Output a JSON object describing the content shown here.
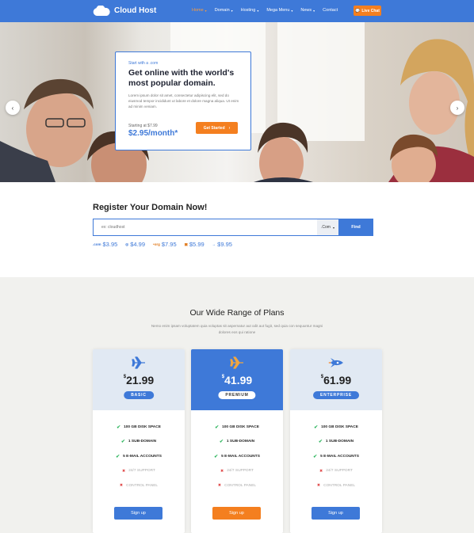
{
  "brand": {
    "name": "Cloud Host"
  },
  "nav": {
    "items": [
      {
        "label": "Home",
        "dropdown": true,
        "active": true
      },
      {
        "label": "Domain",
        "dropdown": true
      },
      {
        "label": "Hosting",
        "dropdown": true
      },
      {
        "label": "Mega Menu",
        "dropdown": true
      },
      {
        "label": "News",
        "dropdown": true
      },
      {
        "label": "Contact",
        "dropdown": false
      }
    ],
    "live_chat": "Live Chat"
  },
  "hero": {
    "eyebrow": "Start with a .com",
    "title": "Get online with the world's most popular domain.",
    "description": "Lorem ipsum dolor sit amet, consectetur adipiscing elit, sed do eiusmod tempor incididunt ut labore et dolore magna aliqua. Ut enim ad minim veniam.",
    "starting_label": "Starting at $7.99",
    "price": "$2.95/month*",
    "cta": "Get Started",
    "prev_arrow": "‹",
    "next_arrow": "›"
  },
  "domain": {
    "title": "Register Your Domain Now!",
    "placeholder": "ex: cloudhost",
    "tld_selected": ".Com",
    "find": "Find",
    "prices": [
      {
        "icon": ".com",
        "price": "$3.95"
      },
      {
        "icon": "◎",
        "price": "$4.99"
      },
      {
        "icon": "•org",
        "price": "$7.95"
      },
      {
        "icon": "▣",
        "price": "$5.99"
      },
      {
        "icon": "→",
        "price": "$9.95"
      }
    ]
  },
  "plans": {
    "title": "Our Wide Range of Plans",
    "subtitle": "Nemo enim ipsam voluptatem quia voluptas sit aspernatur aut odit aut fugit, sed quia con sequuntur magni dolores eos qui ratione",
    "items": [
      {
        "icon": "airplane-icon",
        "currency": "$",
        "price": "21.99",
        "name": "BASIC",
        "features": [
          "100 GB DISK SPACE",
          "1 SUB-DOMAIN",
          "5 E-MAIL ACCOUNTS",
          "24/7 SUPPORT",
          "CONTROL PANEL"
        ],
        "signup": "Sign up"
      },
      {
        "icon": "jet-icon",
        "currency": "$",
        "price": "41.99",
        "name": "PREMIUM",
        "features": [
          "100 GB DISK SPACE",
          "1 SUB-DOMAIN",
          "5 E-MAIL ACCOUNTS",
          "24/7 SUPPORT",
          "CONTROL PANEL"
        ],
        "signup": "Sign up"
      },
      {
        "icon": "rocket-icon",
        "currency": "$",
        "price": "61.99",
        "name": "ENTERPRISE",
        "features": [
          "100 GB DISK SPACE",
          "1 SUB-DOMAIN",
          "5 E-MAIL ACCOUNTS",
          "24/7 SUPPORT",
          "CONTROL PANEL"
        ],
        "signup": "Sign up"
      }
    ],
    "feature_status": [
      "included",
      "included",
      "included",
      "excluded",
      "excluded"
    ]
  },
  "colors": {
    "primary": "#3e79d8",
    "accent": "#f47f1f",
    "check": "#2db55d",
    "cross": "#e04a4a"
  }
}
